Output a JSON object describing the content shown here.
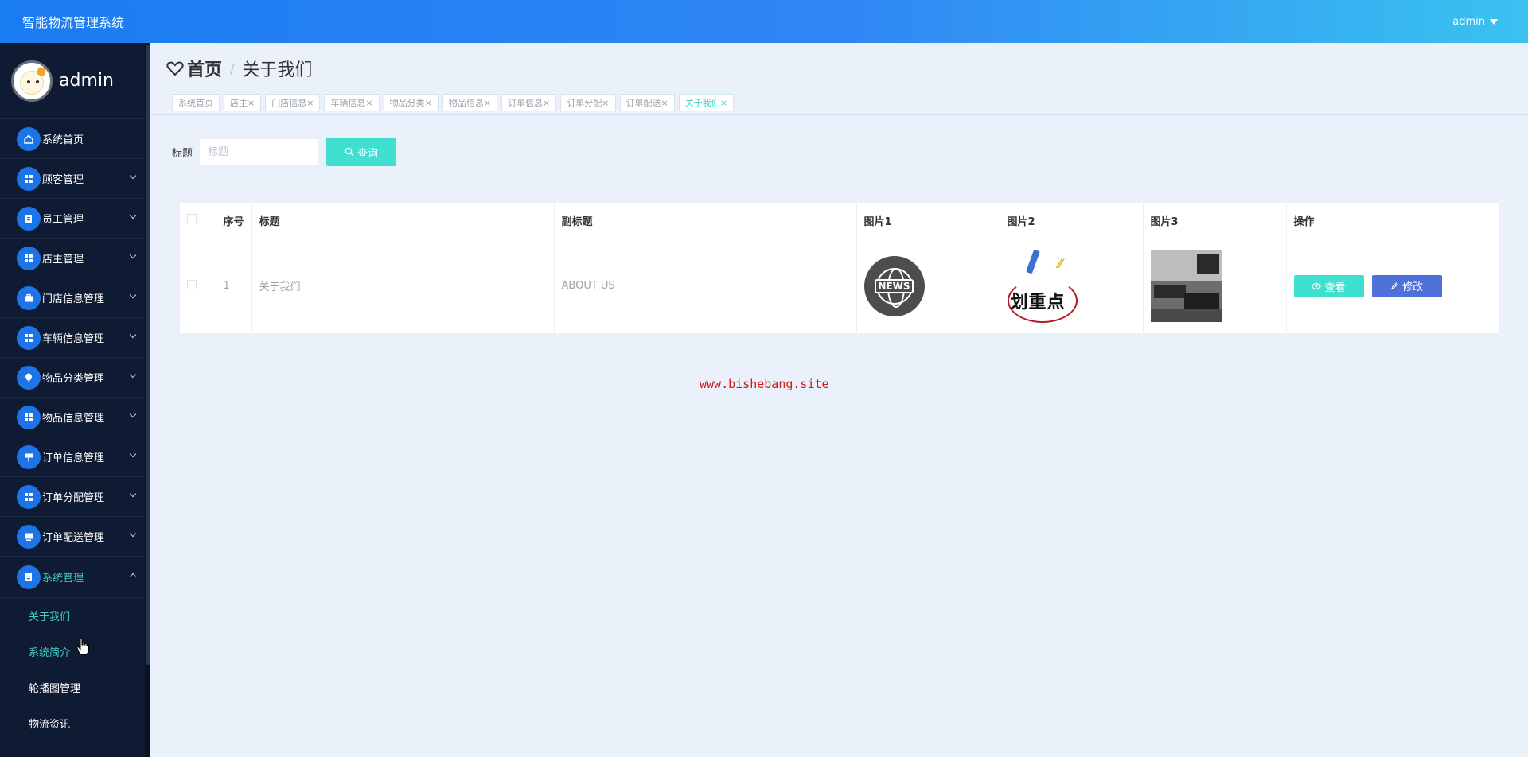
{
  "app": {
    "title": "智能物流管理系统",
    "user_menu": "admin"
  },
  "profile": {
    "name": "admin"
  },
  "sidebar": {
    "items": [
      {
        "label": "系统首页",
        "icon": "home-icon"
      },
      {
        "label": "顾客管理",
        "icon": "grid-icon"
      },
      {
        "label": "员工管理",
        "icon": "clipboard-icon"
      },
      {
        "label": "店主管理",
        "icon": "grid-icon"
      },
      {
        "label": "门店信息管理",
        "icon": "briefcase-icon"
      },
      {
        "label": "车辆信息管理",
        "icon": "grid-icon"
      },
      {
        "label": "物品分类管理",
        "icon": "balloon-icon"
      },
      {
        "label": "物品信息管理",
        "icon": "grid-icon"
      },
      {
        "label": "订单信息管理",
        "icon": "sign-icon"
      },
      {
        "label": "订单分配管理",
        "icon": "grid-icon"
      },
      {
        "label": "订单配送管理",
        "icon": "monitor-icon"
      },
      {
        "label": "系统管理",
        "icon": "clipboard-icon"
      }
    ],
    "sub_items": [
      {
        "label": "关于我们"
      },
      {
        "label": "系统简介"
      },
      {
        "label": "轮播图管理"
      },
      {
        "label": "物流资讯"
      }
    ]
  },
  "breadcrumb": {
    "home": "首页",
    "current": "关于我们"
  },
  "tags": [
    {
      "label": "系统首页"
    },
    {
      "label": "店主×"
    },
    {
      "label": "门店信息×"
    },
    {
      "label": "车辆信息×"
    },
    {
      "label": "物品分类×"
    },
    {
      "label": "物品信息×"
    },
    {
      "label": "订单信息×"
    },
    {
      "label": "订单分配×"
    },
    {
      "label": "订单配送×"
    },
    {
      "label": "关于我们×"
    }
  ],
  "search": {
    "label": "标题",
    "placeholder": "标题",
    "value": "",
    "button": "查询"
  },
  "table": {
    "columns": [
      "",
      "序号",
      "标题",
      "副标题",
      "图片1",
      "图片2",
      "图片3",
      "操作"
    ],
    "rows": [
      {
        "index": "1",
        "title": "关于我们",
        "subtitle": "ABOUT US",
        "img1_text": "NEWS",
        "img2_text": "划重点",
        "view": "查看",
        "edit": "修改"
      }
    ]
  },
  "watermark": "www.bishebang.site",
  "colors": {
    "topbar": "#1a7cf2",
    "sidebar": "#0f1a33",
    "accent": "#3fe0cf",
    "edit": "#4f70d8"
  }
}
